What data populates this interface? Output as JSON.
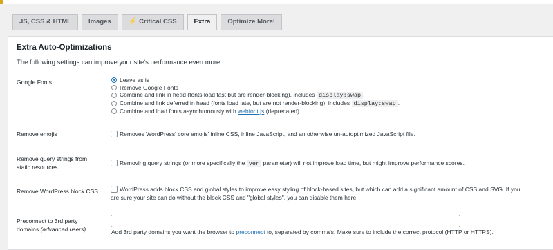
{
  "tabs": [
    {
      "label": "JS, CSS & HTML",
      "active": false
    },
    {
      "label": "Images",
      "active": false
    },
    {
      "label": "Critical CSS",
      "active": false,
      "icon": "lightning-bolt-icon"
    },
    {
      "label": "Extra",
      "active": true
    },
    {
      "label": "Optimize More!",
      "active": false
    }
  ],
  "panel": {
    "title": "Extra Auto-Optimizations",
    "subtitle": "The following settings can improve your site's performance even more."
  },
  "google_fonts": {
    "label": "Google Fonts",
    "options": [
      {
        "text": "Leave as is",
        "checked": true
      },
      {
        "text": "Remove Google Fonts",
        "checked": false
      },
      {
        "text_before": "Combine and link in head (fonts load fast but are render-blocking), includes",
        "code": "display:swap",
        "text_after": ".",
        "checked": false
      },
      {
        "text_before": "Combine and link deferred in head (fonts load late, but are not render-blocking), includes",
        "code": "display:swap",
        "text_after": ".",
        "checked": false
      },
      {
        "text_before": "Combine and load fonts asynchronously with",
        "link": "webfont.js",
        "text_after": "(deprecated)",
        "checked": false
      }
    ]
  },
  "remove_emojis": {
    "label": "Remove emojis",
    "description": "Removes WordPress' core emojis' inline CSS, inline JavaScript, and an otherwise un-autoptimized JavaScript file.",
    "checked": false
  },
  "remove_query_strings": {
    "label_line1": "Remove query strings from",
    "label_line2": "static resources",
    "text_before": "Removing query strings (or more specifically the",
    "code": "ver",
    "text_after": "parameter) will not improve load time, but might improve performance scores.",
    "checked": false
  },
  "remove_block_css": {
    "label": "Remove WordPress block CSS",
    "description_line1": "WordPress adds block CSS and global styles to improve easy styling of block-based sites, but which can add a significant amount of CSS and SVG. If you",
    "description_line2": "are sure your site can do without the block CSS and \"global styles\", you can disable them here.",
    "checked": false
  },
  "preconnect": {
    "label_line1": "Preconnect to 3rd party",
    "label_line2": "domains",
    "label_em": "(advanced users)",
    "value": "",
    "help_before": "Add 3rd party domains you want the browser to",
    "help_link": "preconnect",
    "help_after": "to, separated by comma's. Make sure to include the correct protocol (HTTP or HTTPS)."
  },
  "colors": {
    "accent": "#2271b1",
    "tab_bolt": "#e08b18",
    "notice_border": "#dba617",
    "page_bg": "#f0f0f1"
  }
}
